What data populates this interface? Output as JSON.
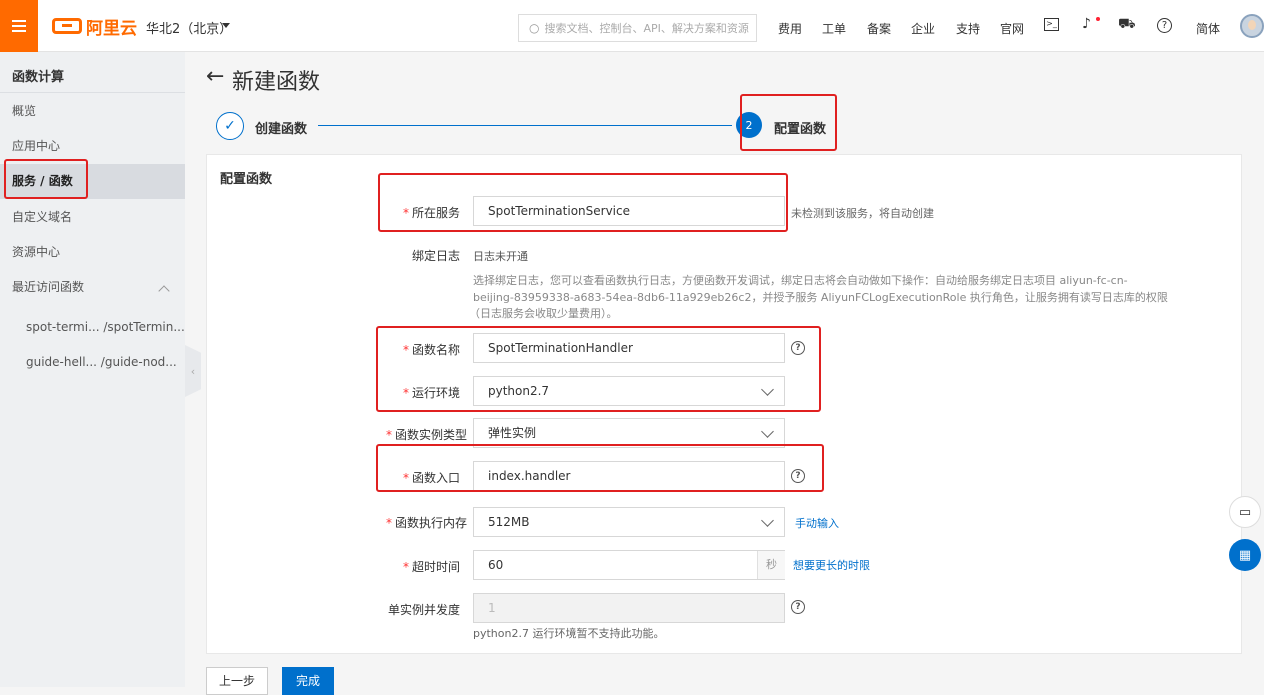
{
  "topbar": {
    "logo_text": "阿里云",
    "region": "华北2（北京）",
    "search_placeholder": "搜索文档、控制台、API、解决方案和资源",
    "links": [
      "费用",
      "工单",
      "备案",
      "企业",
      "支持",
      "官网"
    ],
    "lang": "简体"
  },
  "sidebar": {
    "title": "函数计算",
    "items": [
      "概览",
      "应用中心",
      "服务 / 函数",
      "自定义域名",
      "资源中心",
      "最近访问函数"
    ],
    "recent": [
      "spot-termi...  /spotTermin...",
      "guide-hell...  /guide-nod..."
    ]
  },
  "page": {
    "back": "←",
    "title": "新建函数"
  },
  "steps": {
    "step1_label": "创建函数",
    "step2_number": "2",
    "step2_label": "配置函数"
  },
  "form": {
    "section_title": "配置函数",
    "service_label": "所在服务",
    "service_value": "SpotTerminationService",
    "service_hint": "未检测到该服务，将自动创建",
    "log_label": "绑定日志",
    "log_value": "日志未开通",
    "log_desc_1": "选择绑定日志，您可以查看函数执行日志，方便函数开发调试，绑定日志将会自动做如下操作：自动给服务绑定日志项目 aliyun-fc-cn-",
    "log_desc_2": "beijing-83959338-a683-54ea-8db6-11a929eb26c2，并授予服务 AliyunFCLogExecutionRole 执行角色，让服务拥有读写日志库的权限",
    "log_desc_3": "（日志服务会收取少量费用）。",
    "name_label": "函数名称",
    "name_value": "SpotTerminationHandler",
    "runtime_label": "运行环境",
    "runtime_value": "python2.7",
    "instance_type_label": "函数实例类型",
    "instance_type_value": "弹性实例",
    "handler_label": "函数入口",
    "handler_value": "index.handler",
    "memory_label": "函数执行内存",
    "memory_value": "512MB",
    "memory_link": "手动输入",
    "timeout_label": "超时时间",
    "timeout_value": "60",
    "timeout_unit": "秒",
    "timeout_link": "想要更长的时限",
    "concurrency_label": "单实例并发度",
    "concurrency_value": "1",
    "concurrency_hint": "python2.7 运行环境暂不支持此功能。",
    "required_mark": "*"
  },
  "buttons": {
    "prev": "上一步",
    "done": "完成"
  },
  "colors": {
    "accent": "#0070cc",
    "brand": "#ff6a00",
    "highlight": "#e02020"
  }
}
